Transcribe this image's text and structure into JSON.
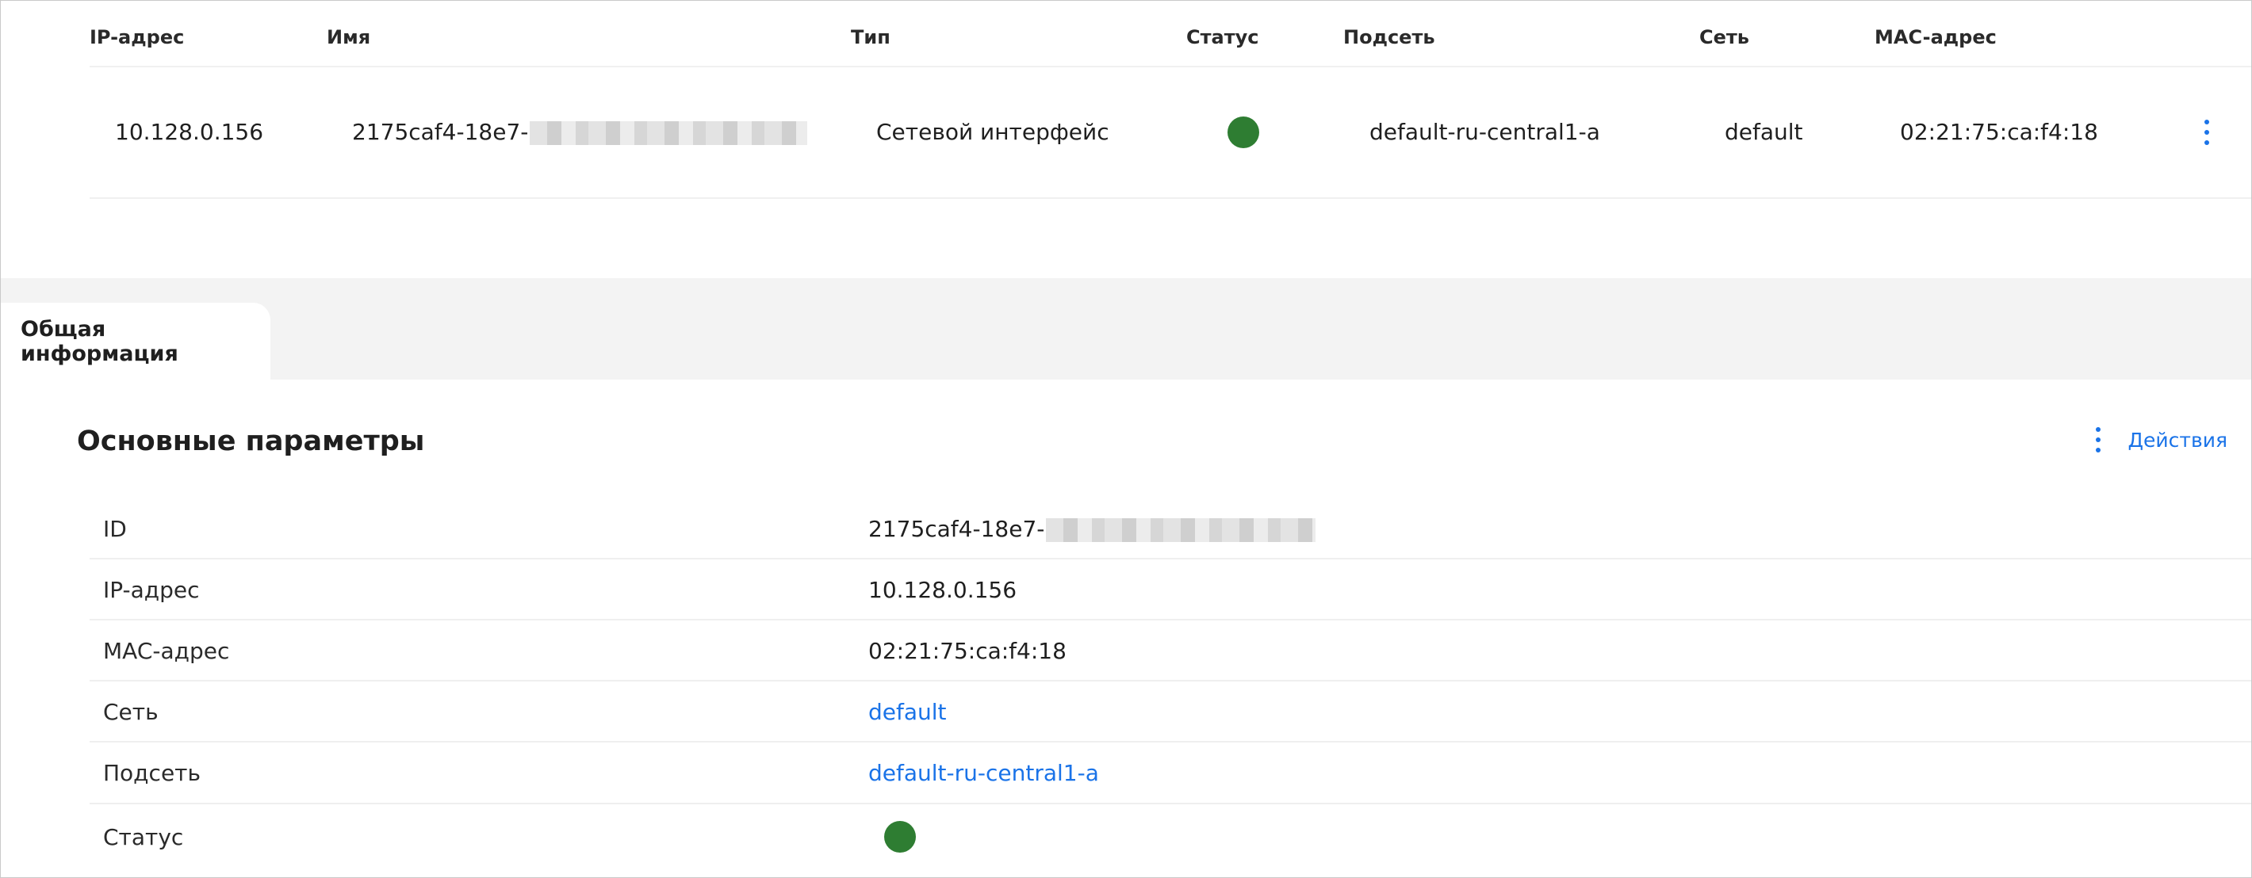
{
  "table": {
    "headers": {
      "ip": "IP-адрес",
      "name": "Имя",
      "type": "Тип",
      "status": "Статус",
      "subnet": "Подсеть",
      "network": "Сеть",
      "mac": "MAC-адрес"
    },
    "row": {
      "ip": "10.128.0.156",
      "name": "2175caf4-18e7-",
      "type": "Сетевой интерфейс",
      "status_color": "#2e7d32",
      "subnet": "default-ru-central1-a",
      "network": "default",
      "mac": "02:21:75:ca:f4:18"
    }
  },
  "tabs": [
    {
      "label": "Общая информация",
      "active": true
    }
  ],
  "details": {
    "title": "Основные параметры",
    "actions_label": "Действия",
    "rows": [
      {
        "label": "ID",
        "value": "2175caf4-18e7-"
      },
      {
        "label": "IP-адрес",
        "value": "10.128.0.156"
      },
      {
        "label": "MAC-адрес",
        "value": "02:21:75:ca:f4:18"
      },
      {
        "label": "Сеть",
        "value": "default"
      },
      {
        "label": "Подсеть",
        "value": "default-ru-central1-a"
      },
      {
        "label": "Статус",
        "status_color": "#2e7d32"
      }
    ]
  },
  "colors": {
    "accent": "#1a73e8",
    "status_ok": "#2e7d32",
    "band": "#f3f3f3"
  },
  "icons": {
    "row_menu": "more-vertical-icon",
    "actions_menu": "more-vertical-icon",
    "status": "status-running-icon"
  }
}
